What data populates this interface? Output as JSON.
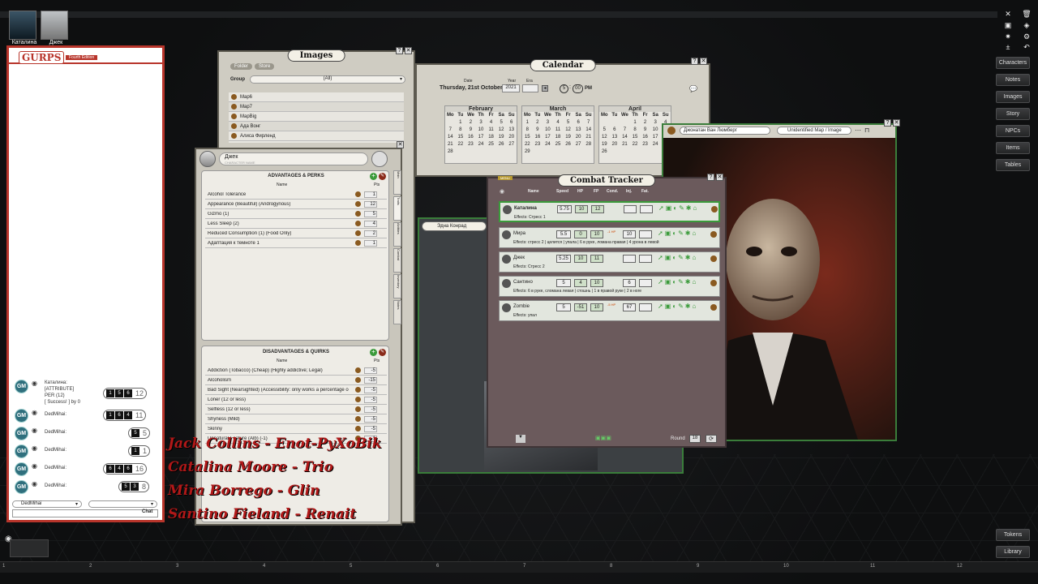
{
  "party": [
    {
      "name": "Каталина"
    },
    {
      "name": "Джек"
    }
  ],
  "right_menu": [
    "Characters",
    "Notes",
    "Images",
    "Story",
    "NPCs",
    "Items",
    "Tables"
  ],
  "bottom_right": [
    "Tokens",
    "Library"
  ],
  "gurps": {
    "logo": "GURPS",
    "edition": "Fourth Edition"
  },
  "chat": {
    "entries": [
      {
        "speaker": "Каталина:",
        "lines": [
          "[ATTRIBUTE]",
          "PER (12)",
          "[ Success! ] by 0"
        ],
        "dice": [
          "1",
          "5",
          "6"
        ],
        "total": "12"
      },
      {
        "speaker": "DedMihai:",
        "dice": [
          "1",
          "6",
          "4"
        ],
        "total": "11"
      },
      {
        "speaker": "DedMihai:",
        "dice": [
          "5"
        ],
        "total": ""
      },
      {
        "speaker": "DedMihai:",
        "dice": [
          "1"
        ],
        "total": ""
      },
      {
        "speaker": "DedMihai:",
        "dice": [
          "6",
          "4",
          "6"
        ],
        "total": "16"
      },
      {
        "speaker": "DedMihai:",
        "dice": [
          "5",
          "3"
        ],
        "total": "8"
      }
    ],
    "identity": "DedMihai",
    "send": "Chat"
  },
  "images_window": {
    "title": "Images",
    "tabs": [
      "Folder",
      "Store"
    ],
    "group_label": "Group",
    "group_value": "(All)",
    "items": [
      "Map6",
      "Map7",
      "MapBig",
      "Ада Вонг",
      "Алиса Фирленд"
    ]
  },
  "calendar": {
    "title": "Calendar",
    "date_label": "Date",
    "date": "Thursday, 21st October",
    "year_label": "Year",
    "year": "2021",
    "era_label": "Era",
    "hour": "5",
    "minute": "00",
    "ampm": "PM",
    "months": [
      {
        "name": "February",
        "days": [
          "Mo",
          "Tu",
          "We",
          "Th",
          "Fr",
          "Sa",
          "Su",
          "",
          "1",
          "2",
          "3",
          "4",
          "5",
          "6",
          "7",
          "8",
          "9",
          "10",
          "11",
          "12",
          "13",
          "14",
          "15",
          "16",
          "17",
          "18",
          "19",
          "20",
          "21",
          "22",
          "23",
          "24",
          "25",
          "26",
          "27",
          "28"
        ]
      },
      {
        "name": "March",
        "days": [
          "Mo",
          "Tu",
          "We",
          "Th",
          "Fr",
          "Sa",
          "Su",
          "1",
          "2",
          "3",
          "4",
          "5",
          "6",
          "7",
          "8",
          "9",
          "10",
          "11",
          "12",
          "13",
          "14",
          "15",
          "16",
          "17",
          "18",
          "19",
          "20",
          "21",
          "22",
          "23",
          "24",
          "25",
          "26",
          "27",
          "28",
          "29"
        ]
      },
      {
        "name": "April",
        "days": [
          "Mo",
          "Tu",
          "We",
          "Th",
          "Fr",
          "Sa",
          "Su",
          "",
          "",
          "",
          "1",
          "2",
          "3",
          "4",
          "5",
          "6",
          "7",
          "8",
          "9",
          "10",
          "11",
          "12",
          "13",
          "14",
          "15",
          "16",
          "17",
          "18",
          "19",
          "20",
          "21",
          "22",
          "23",
          "24",
          "25",
          "26"
        ]
      }
    ]
  },
  "charsheet": {
    "name": "Джек",
    "name_hint": "CHARACTER NAME",
    "adv_title": "ADVANTAGES & PERKS",
    "col_name": "Name",
    "col_pts": "Pts",
    "advantages": [
      {
        "n": "Alcohol Tolerance",
        "p": "1"
      },
      {
        "n": "Appearance (Beautiful) (Androgynous)",
        "p": "12"
      },
      {
        "n": "Gizmo (1)",
        "p": "5"
      },
      {
        "n": "Less Sleep (2)",
        "p": "4"
      },
      {
        "n": "Reduced Consumption (1) (Food Only)",
        "p": "2"
      },
      {
        "n": "Адаптация к темноте 1",
        "p": "1"
      }
    ],
    "dis_title": "DISADVANTAGES & QUIRKS",
    "disadvantages": [
      {
        "n": "Addiction (Tobacco) (Cheap) (Highly addictive; Legal)",
        "p": "-5"
      },
      {
        "n": "Alcoholism",
        "p": "-15"
      },
      {
        "n": "Bad Sight (Nearsighted) (Accessibility: only works a percentage o",
        "p": "-5"
      },
      {
        "n": "Loner (12 or less)",
        "p": "-5"
      },
      {
        "n": "Selfless (12 or less)",
        "p": "-5"
      },
      {
        "n": "Shyness (Mild)",
        "p": "-5"
      },
      {
        "n": "Skinny",
        "p": "-5"
      },
      {
        "n": "Unnatural Feature (Alb) (-1)",
        "p": "-1"
      }
    ],
    "side_tabs": [
      "Main",
      "Traits",
      "Abilities",
      "Combat",
      "Inventory",
      "Notes"
    ]
  },
  "combat": {
    "title": "Combat Tracker",
    "menu": "MENU",
    "headers": [
      "Name",
      "Speed",
      "HP",
      "FP",
      "Cond.",
      "Inj.",
      "Fat."
    ],
    "rows": [
      {
        "name": "Каталина",
        "speed": "5.75",
        "hp": "10",
        "fp": "12",
        "inj": "",
        "effects": "Effects: Стресс 1"
      },
      {
        "name": "Мира",
        "speed": "5.5",
        "hp": "0",
        "fp": "10",
        "tag": "-1 HP",
        "inj": "10",
        "effects": "Effects: стресс 2 | целится | упала | 6 в руке, ломана правая | 4 урона в левой"
      },
      {
        "name": "Джек",
        "speed": "5.25",
        "hp": "10",
        "fp": "11",
        "inj": "",
        "effects": "Effects: Стресс 2"
      },
      {
        "name": "Сантино",
        "speed": "5",
        "hp": "4",
        "fp": "10",
        "inj": "6",
        "effects": "Effects: 6 в руке, сломана левая | стошнь | 1 в правой руке | 2 в ноге"
      },
      {
        "name": "Zombie",
        "speed": "5",
        "hp": "-51",
        "fp": "10",
        "tag": "-5 HP",
        "inj": "67",
        "effects": "Effects: упал"
      }
    ],
    "round_label": "Round",
    "round": "18"
  },
  "edna": {
    "name": "Эдна Конрад"
  },
  "portrait_window": {
    "name": "Джонатан Ван Люмберг",
    "type": "Unidentified Map / Image"
  },
  "credits": [
    "Jack Collins - Enot-PyXoBik",
    "Catalina Moore - Trio",
    "Mira Borrego - Glin",
    "Santino Fieland - Renait"
  ],
  "ruler": [
    "1",
    "2",
    "3",
    "4",
    "5",
    "6",
    "7",
    "8",
    "9",
    "10",
    "11",
    "12"
  ],
  "colors": {
    "accent_red": "#b8352b",
    "combat_green": "#3a9a3a",
    "panel": "#d9d6cc"
  }
}
